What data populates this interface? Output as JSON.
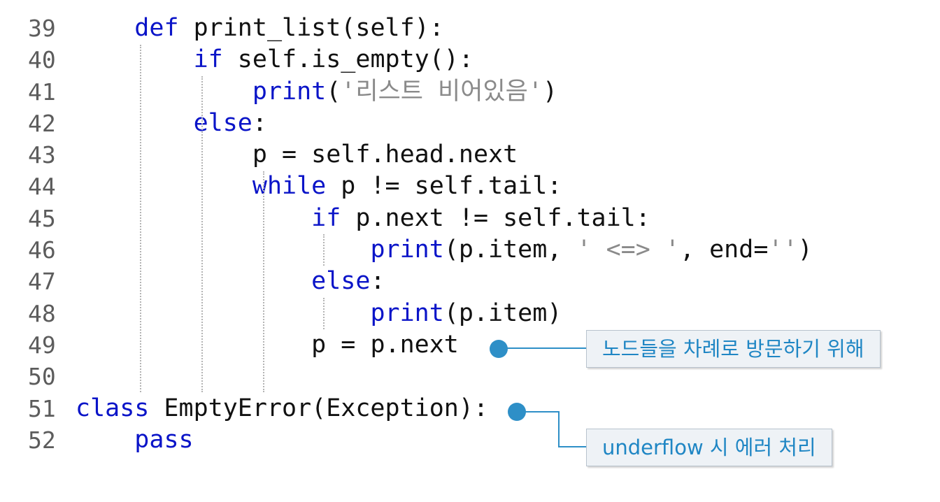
{
  "code": {
    "lines": [
      {
        "number": "39",
        "indent": "    ",
        "tokens": [
          {
            "t": "kw",
            "text": "def"
          },
          {
            "t": "plain",
            "text": " print_list(self):"
          }
        ]
      },
      {
        "number": "40",
        "indent": "        ",
        "tokens": [
          {
            "t": "kw",
            "text": "if"
          },
          {
            "t": "plain",
            "text": " self.is_empty():"
          }
        ]
      },
      {
        "number": "41",
        "indent": "            ",
        "tokens": [
          {
            "t": "kw",
            "text": "print"
          },
          {
            "t": "plain",
            "text": "("
          },
          {
            "t": "str",
            "text": "'리스트 비어있음'"
          },
          {
            "t": "plain",
            "text": ")"
          }
        ]
      },
      {
        "number": "42",
        "indent": "        ",
        "tokens": [
          {
            "t": "kw",
            "text": "else"
          },
          {
            "t": "plain",
            "text": ":"
          }
        ]
      },
      {
        "number": "43",
        "indent": "            ",
        "tokens": [
          {
            "t": "plain",
            "text": "p = self.head.next"
          }
        ]
      },
      {
        "number": "44",
        "indent": "            ",
        "tokens": [
          {
            "t": "kw",
            "text": "while"
          },
          {
            "t": "plain",
            "text": " p != self.tail:"
          }
        ]
      },
      {
        "number": "45",
        "indent": "                ",
        "tokens": [
          {
            "t": "kw",
            "text": "if"
          },
          {
            "t": "plain",
            "text": " p.next != self.tail:"
          }
        ]
      },
      {
        "number": "46",
        "indent": "                    ",
        "tokens": [
          {
            "t": "kw",
            "text": "print"
          },
          {
            "t": "plain",
            "text": "(p.item, "
          },
          {
            "t": "str",
            "text": "' <=> '"
          },
          {
            "t": "plain",
            "text": ", end="
          },
          {
            "t": "str",
            "text": "''"
          },
          {
            "t": "plain",
            "text": ")"
          }
        ]
      },
      {
        "number": "47",
        "indent": "                ",
        "tokens": [
          {
            "t": "kw",
            "text": "else"
          },
          {
            "t": "plain",
            "text": ":"
          }
        ]
      },
      {
        "number": "48",
        "indent": "                    ",
        "tokens": [
          {
            "t": "kw",
            "text": "print"
          },
          {
            "t": "plain",
            "text": "(p.item)"
          }
        ]
      },
      {
        "number": "49",
        "indent": "                ",
        "tokens": [
          {
            "t": "plain",
            "text": "p = p.next"
          }
        ]
      },
      {
        "number": "50",
        "indent": "",
        "tokens": []
      },
      {
        "number": "51",
        "indent": "",
        "tokens": [
          {
            "t": "kw",
            "text": "class"
          },
          {
            "t": "plain",
            "text": " EmptyError(Exception):"
          }
        ]
      },
      {
        "number": "52",
        "indent": "    ",
        "tokens": [
          {
            "t": "kw",
            "text": "pass"
          }
        ]
      }
    ]
  },
  "annotations": {
    "traverse": "노드들을 차례로 방문하기 위해",
    "underflow": "underflow 시 에러 처리"
  },
  "colors": {
    "keyword": "#0a14c8",
    "string": "#8a8a8a",
    "callout_text": "#1f86c4",
    "marker": "#2e8fc7"
  }
}
